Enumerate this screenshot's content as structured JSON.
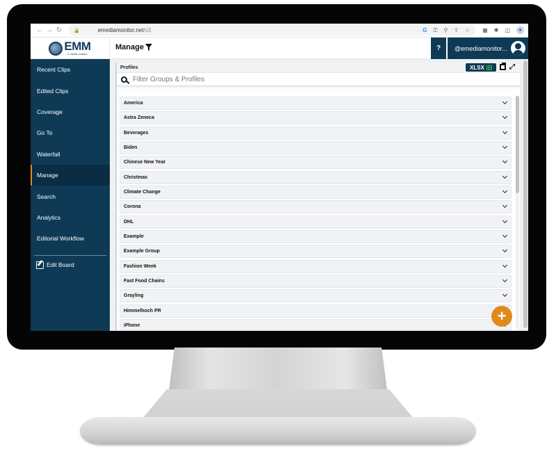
{
  "browser": {
    "url_host": "emediamonitor.net",
    "url_path": "/v3",
    "nav_icons": [
      "back-icon",
      "forward-icon",
      "reload-icon"
    ],
    "address_icons": [
      "google-icon",
      "key-icon",
      "zoom-icon",
      "share-icon",
      "star-icon"
    ],
    "extension_icons": [
      "extension-app-icon",
      "puzzle-icon",
      "sidepanel-icon",
      "profile-icon"
    ]
  },
  "header": {
    "logo_text": "EMM",
    "logo_subtext": "e media monitor",
    "page_title": "Manage",
    "help_label": "?",
    "user_label": "@emediamonitor..."
  },
  "sidebar": {
    "items": [
      {
        "label": "Recent Clips",
        "active": false
      },
      {
        "label": "Edited Clips",
        "active": false
      },
      {
        "label": "Coverage",
        "active": false
      },
      {
        "label": "Go To",
        "active": false
      },
      {
        "label": "Waterfall",
        "active": false
      },
      {
        "label": "Manage",
        "active": true
      },
      {
        "label": "Search",
        "active": false
      },
      {
        "label": "Analytics",
        "active": false
      },
      {
        "label": "Editorial Workflow",
        "active": false
      }
    ],
    "edit_board_label": "Edit Board"
  },
  "profiles": {
    "title": "Profiles",
    "xlsx_label": "XLSX",
    "filter_placeholder": "Filter Groups & Profiles",
    "items": [
      "America",
      "Astra Zeneca",
      "Beverages",
      "Biden",
      "Chinese New Year",
      "Christmas",
      "Climate Change",
      "Corona",
      "DHL",
      "Example",
      "Example Group",
      "Fashion Week",
      "Fast Food Chains",
      "Grayling",
      "Himmelhoch PR",
      "iPhone"
    ]
  },
  "fab_label": "+",
  "colors": {
    "brand_navy": "#0e3a56",
    "accent_orange": "#e08a1e",
    "excel_green": "#3cc03c"
  }
}
